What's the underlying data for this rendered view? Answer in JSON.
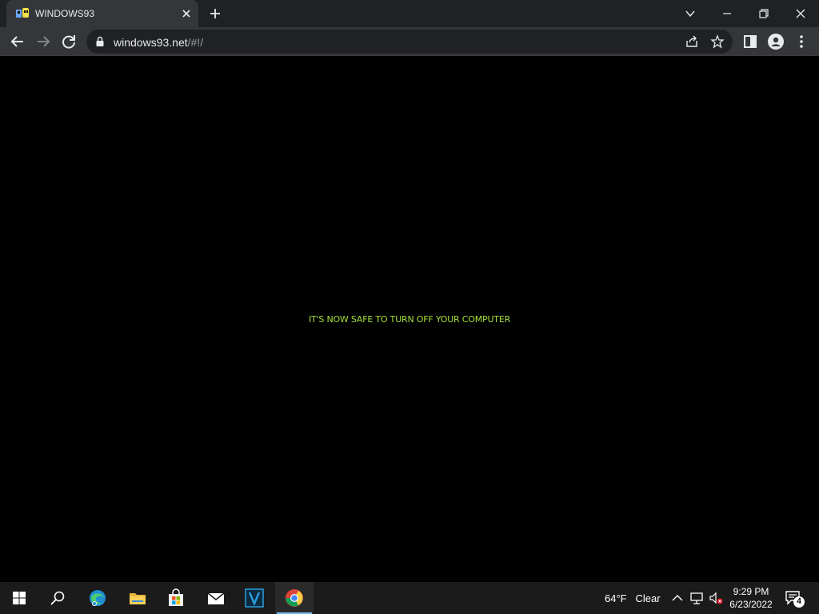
{
  "browser": {
    "tab_title": "WINDOWS93",
    "url_host": "windows93.net",
    "url_path": "/#!/"
  },
  "page": {
    "message": "IT'S NOW SAFE TO TURN OFF YOUR COMPUTER",
    "message_color": "#a6e03a"
  },
  "taskbar": {
    "weather_temp": "64°F",
    "weather_desc": "Clear",
    "time": "9:29 PM",
    "date": "6/23/2022",
    "notification_count": "4",
    "apps": [
      "start-icon",
      "search-icon",
      "edge-icon",
      "file-explorer-icon",
      "store-icon",
      "mail-icon",
      "v-app-icon",
      "chrome-icon"
    ]
  }
}
